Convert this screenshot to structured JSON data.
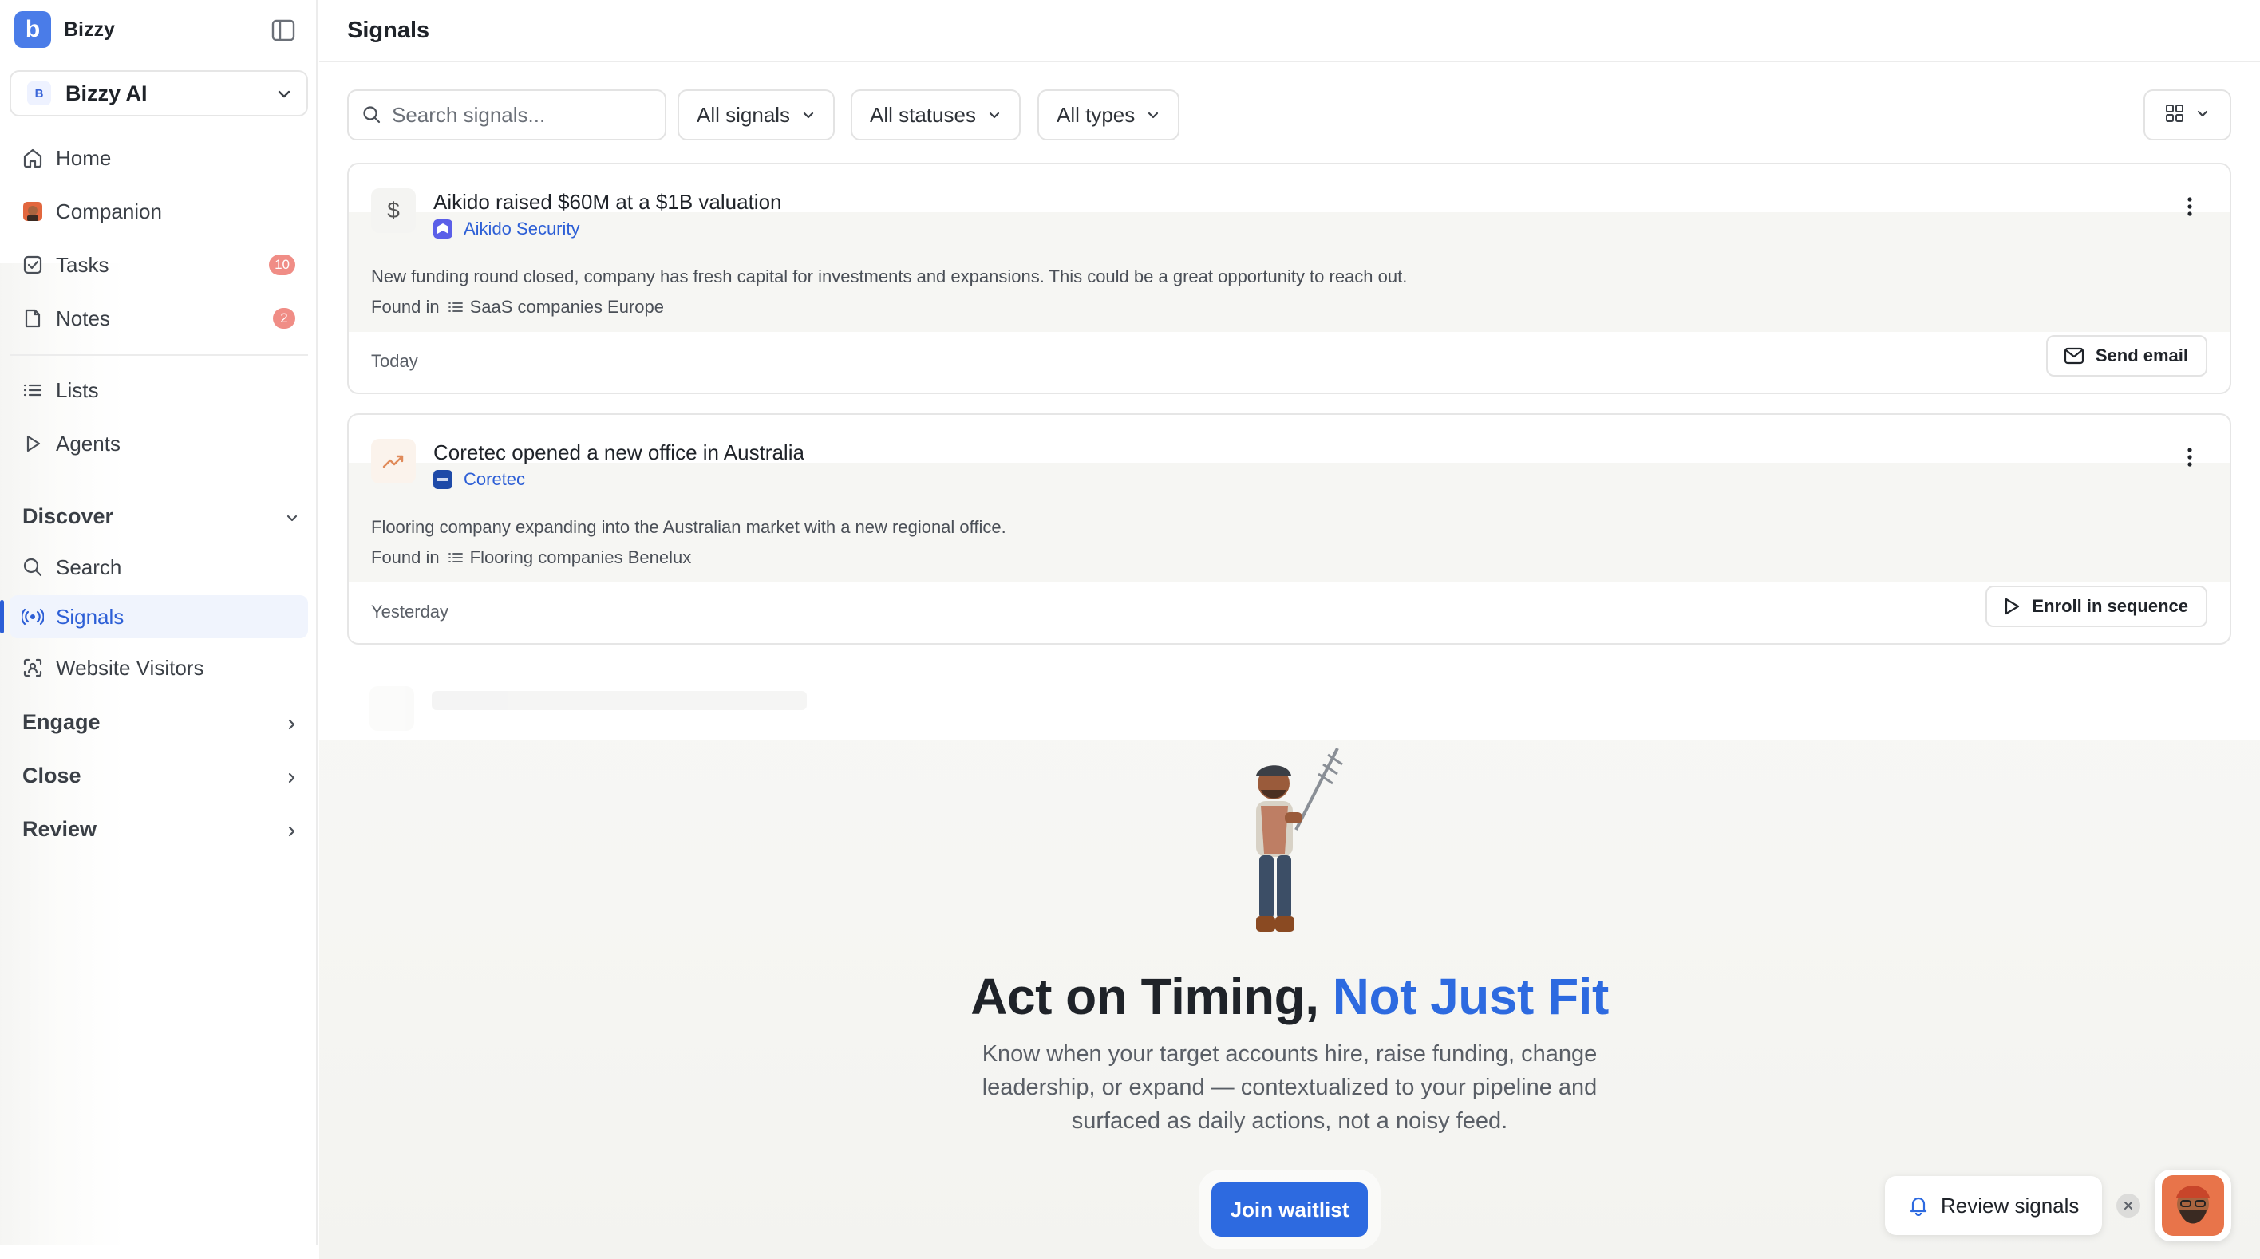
{
  "app": {
    "name": "Bizzy",
    "logo_letter": "b"
  },
  "workspace": {
    "avatar_letter": "B",
    "name": "Bizzy AI"
  },
  "sidebar": {
    "items": [
      {
        "label": "Home"
      },
      {
        "label": "Companion"
      },
      {
        "label": "Tasks",
        "badge": "10"
      },
      {
        "label": "Notes",
        "badge": "2"
      },
      {
        "label": "Lists"
      },
      {
        "label": "Agents"
      }
    ],
    "discover": {
      "label": "Discover",
      "items": [
        {
          "label": "Search"
        },
        {
          "label": "Signals"
        },
        {
          "label": "Website Visitors"
        }
      ]
    },
    "sections": [
      {
        "label": "Engage"
      },
      {
        "label": "Close"
      },
      {
        "label": "Review"
      }
    ]
  },
  "header": {
    "title": "Signals"
  },
  "toolbar": {
    "search_placeholder": "Search signals...",
    "filters": [
      {
        "label": "All signals"
      },
      {
        "label": "All statuses"
      },
      {
        "label": "All types"
      }
    ]
  },
  "signals": [
    {
      "title": "Aikido raised $60M at a $1B valuation",
      "company": "Aikido Security",
      "description": "New funding round closed, company has fresh capital for investments and expansions. This could be a great opportunity to reach out.",
      "found_in_label": "Found in",
      "list": "SaaS companies Europe",
      "date": "Today",
      "action": "Send email",
      "icon": "dollar-icon"
    },
    {
      "title": "Coretec opened a new office in Australia",
      "company": "Coretec",
      "description": "Flooring company expanding into the Australian market with a new regional office.",
      "found_in_label": "Found in",
      "list": "Flooring companies Benelux",
      "date": "Yesterday",
      "action": "Enroll in sequence",
      "icon": "trending-up-icon"
    }
  ],
  "promo": {
    "headline_start": "Act on Timing, ",
    "headline_accent": "Not Just Fit",
    "subtext": "Know when your target accounts hire, raise funding, change leadership, or expand — contextualized to your pipeline and surfaced as daily actions, not a noisy feed.",
    "cta": "Join waitlist"
  },
  "assistant": {
    "review_label": "Review signals"
  },
  "colors": {
    "accent": "#2d6ae0",
    "brand": "#4a7ce8",
    "badge": "#f08d86",
    "active_nav_bg": "#f0f4fd"
  }
}
